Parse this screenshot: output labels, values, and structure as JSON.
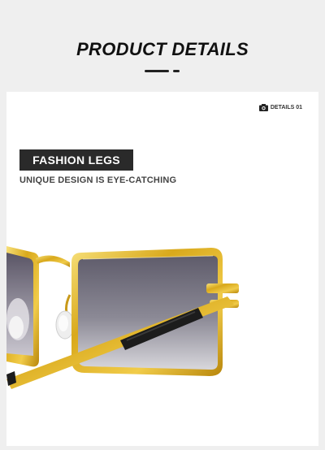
{
  "header": {
    "title": "PRODUCT DETAILS"
  },
  "card": {
    "tag_label": "DETAILS 01",
    "feature_title": "FASHION LEGS",
    "feature_subtitle": "UNIQUE DESIGN IS EYE-CATCHING"
  },
  "colors": {
    "background": "#efefef",
    "card": "#ffffff",
    "label_box": "#2a2a2a",
    "gold_frame": "#d9a91c",
    "lens": "#6b6878"
  },
  "icons": {
    "details_tag": "camera-icon"
  }
}
